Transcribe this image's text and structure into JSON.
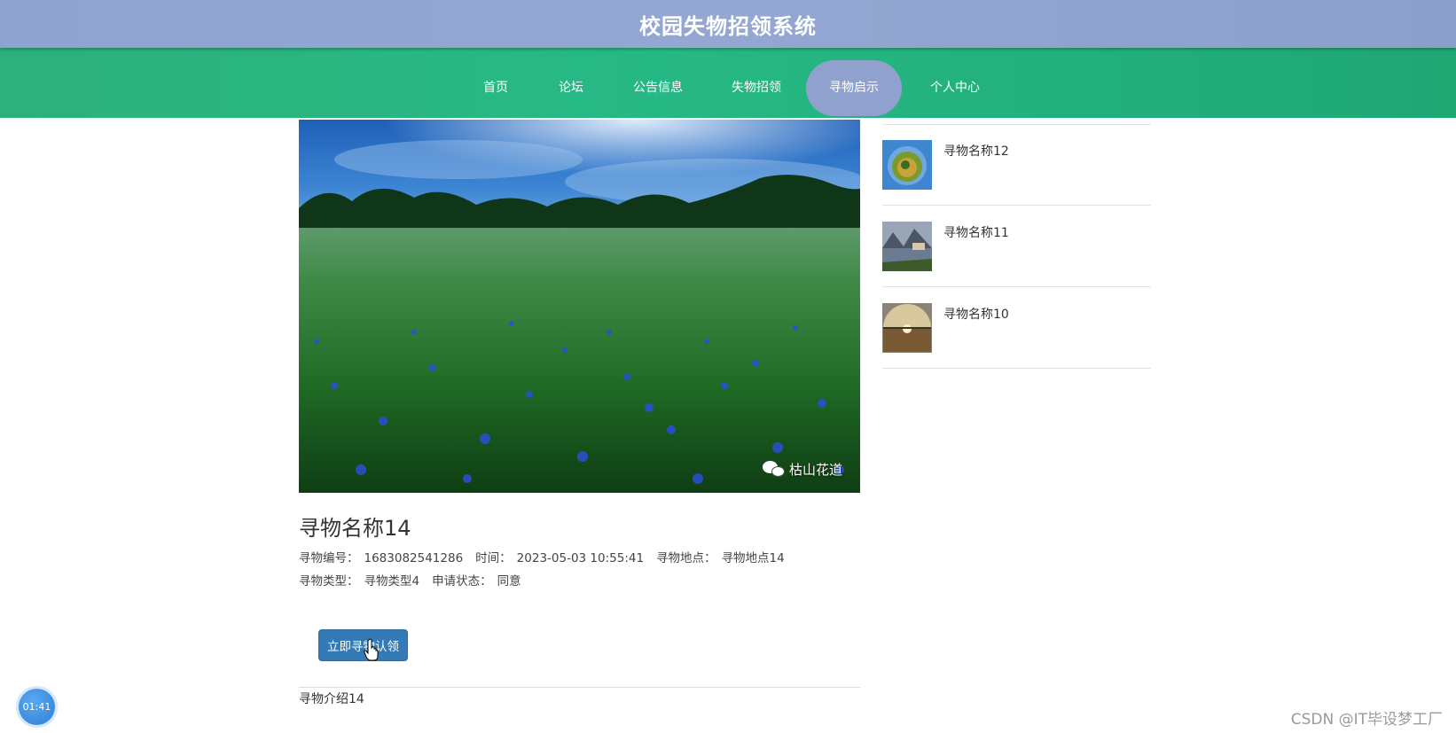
{
  "header": {
    "title": "校园失物招领系统"
  },
  "nav": {
    "items": [
      {
        "label": "首页"
      },
      {
        "label": "论坛"
      },
      {
        "label": "公告信息"
      },
      {
        "label": "失物招领"
      },
      {
        "label": "寻物启示"
      },
      {
        "label": "个人中心"
      }
    ],
    "active": "寻物启示"
  },
  "colors": {
    "header_bg": "#94a7d2",
    "nav_bg": "#27b985",
    "nav_active": "#8fa1cc",
    "button_primary": "#337ab7"
  },
  "detail": {
    "image_watermark": "枯山花道",
    "title": "寻物名称14",
    "meta": {
      "code_label": "寻物编号：",
      "code_value": "1683082541286",
      "time_label": "时间：",
      "time_value": "2023-05-03 10:55:41",
      "place_label": "寻物地点：",
      "place_value": "寻物地点14",
      "type_label": "寻物类型：",
      "type_value": "寻物类型4",
      "status_label": "申请状态：",
      "status_value": "同意"
    },
    "claim_button": "立即寻物认领",
    "description": "寻物介绍14"
  },
  "sidebar": {
    "items": [
      {
        "label": "寻物名称12",
        "thumb_icon": "tiny-planet-thumb"
      },
      {
        "label": "寻物名称11",
        "thumb_icon": "lake-town-thumb"
      },
      {
        "label": "寻物名称10",
        "thumb_icon": "sunset-thumb"
      }
    ]
  },
  "overlay": {
    "timer": "01:41",
    "watermark": "CSDN @IT毕设梦工厂"
  }
}
